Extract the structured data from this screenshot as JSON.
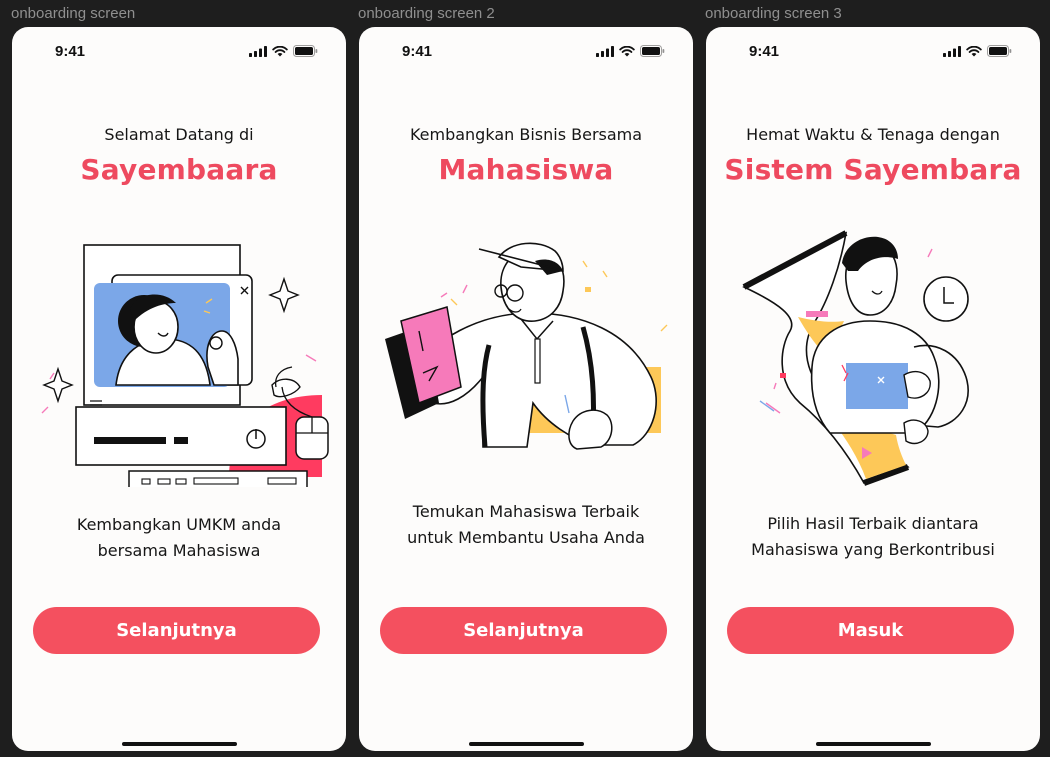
{
  "screens": [
    {
      "frame_label": "onboarding screen",
      "time": "9:41",
      "pre_title": "Selamat Datang di",
      "title": "Sayembaara",
      "description_line1": "Kembangkan UMKM anda",
      "description_line2": "bersama Mahasiswa",
      "button_label": "Selanjutnya",
      "illustration": "computer-video-call"
    },
    {
      "frame_label": "onboarding screen 2",
      "time": "9:41",
      "pre_title": "Kembangkan Bisnis Bersama",
      "title": "Mahasiswa",
      "description_line1": "Temukan Mahasiswa Terbaik",
      "description_line2": "untuk Membantu Usaha Anda",
      "button_label": "Selanjutnya",
      "illustration": "student-with-book"
    },
    {
      "frame_label": "onboarding screen 3",
      "time": "9:41",
      "pre_title": "Hemat Waktu & Tenaga dengan",
      "title": "Sistem Sayembara",
      "description_line1": "Pilih Hasil Terbaik diantara",
      "description_line2": "Mahasiswa yang Berkontribusi",
      "button_label": "Masuk",
      "illustration": "hourglass-person"
    }
  ],
  "colors": {
    "accent": "#ee4a5f",
    "button": "#f4505f",
    "background": "#1e1e1e",
    "screen": "#fdfcfb",
    "illustration_blue": "#7ba7e8",
    "illustration_yellow": "#fdc858",
    "illustration_pink": "#f67aba",
    "illustration_red": "#ff3b60"
  },
  "icons": [
    "signal-icon",
    "wifi-icon",
    "battery-icon"
  ]
}
